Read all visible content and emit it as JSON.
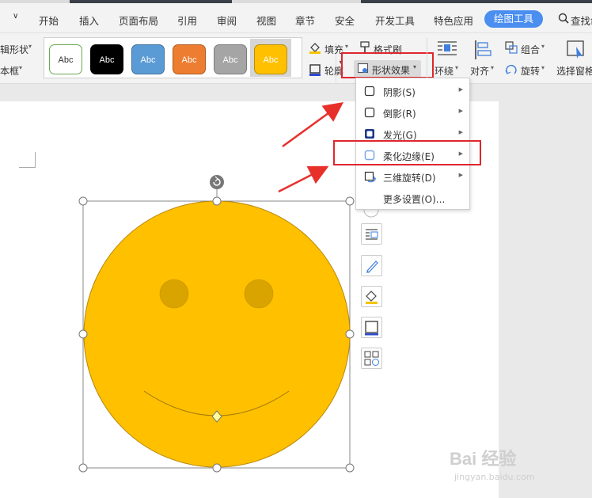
{
  "menubar": {
    "collapse_icon": "chevron-down",
    "tabs": [
      "开始",
      "插入",
      "页面布局",
      "引用",
      "审阅",
      "视图",
      "章节",
      "安全",
      "开发工具",
      "特色应用"
    ],
    "active_tab": "绘图工具",
    "search_label": "查找命"
  },
  "ribbon": {
    "left_edit_shape": "辑形状",
    "left_textbox": "本框",
    "style_swatches": [
      {
        "label": "Abc",
        "bg": "#ffffff",
        "border": "#6aa84f",
        "fg": "#333333"
      },
      {
        "label": "Abc",
        "bg": "#000000",
        "border": "#000000",
        "fg": "#ffffff"
      },
      {
        "label": "Abc",
        "bg": "#5b9bd5",
        "border": "#41719c",
        "fg": "#ffffff"
      },
      {
        "label": "Abc",
        "bg": "#ed7d31",
        "border": "#ae5a21",
        "fg": "#ffffff"
      },
      {
        "label": "Abc",
        "bg": "#a5a5a5",
        "border": "#7b7b7b",
        "fg": "#ffffff"
      },
      {
        "label": "Abc",
        "bg": "#ffc000",
        "border": "#bc8c00",
        "fg": "#ffffff"
      }
    ],
    "fill_label": "填充",
    "outline_label": "轮廓",
    "format_painter_label": "格式刷",
    "shape_effects_label": "形状效果",
    "wrap_label": "环绕",
    "align_label": "对齐",
    "group_label": "组合",
    "rotate_label": "旋转",
    "selection_pane_label": "选择窗格"
  },
  "effects_menu": {
    "items": [
      {
        "label": "阴影(S)",
        "has_submenu": true,
        "icon": "shadow-square-icon"
      },
      {
        "label": "倒影(R)",
        "has_submenu": true,
        "icon": "reflection-square-icon"
      },
      {
        "label": "发光(G)",
        "has_submenu": true,
        "icon": "glow-square-icon"
      },
      {
        "label": "柔化边缘(E)",
        "has_submenu": true,
        "icon": "soft-edge-square-icon"
      },
      {
        "label": "三维旋转(D)",
        "has_submenu": true,
        "icon": "3d-rotation-icon"
      },
      {
        "label": "更多设置(O)...",
        "has_submenu": false,
        "icon": ""
      }
    ]
  },
  "canvas": {
    "shape": "smiley-face",
    "fill_color": "#ffc000",
    "outline_color": "#b8860b",
    "eye_color": "#d9a400",
    "selected": true
  },
  "watermark": {
    "main": "Bai 经验",
    "url": "jingyan.baidu.com"
  },
  "colors": {
    "accent": "#4a8ef0",
    "highlight": "#e0262c",
    "arrow": "#e8302b"
  }
}
